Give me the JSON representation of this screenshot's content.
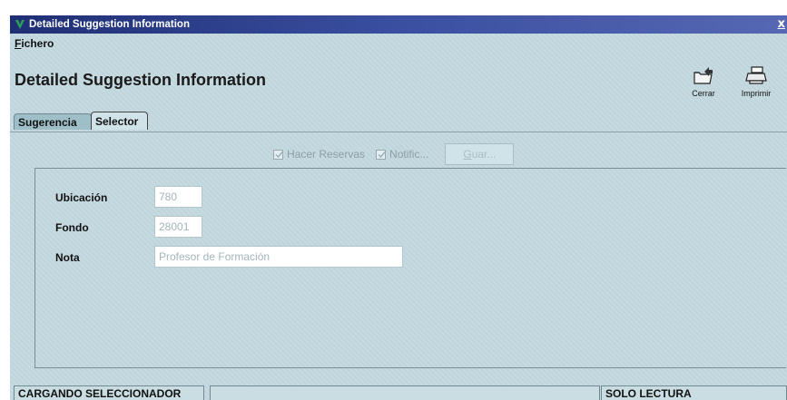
{
  "window": {
    "title": "Detailed Suggestion Information",
    "close_symbol": "x"
  },
  "menu": {
    "file_label_underlined": "F",
    "file_label_rest": "ichero"
  },
  "heading": "Detailed Suggestion Information",
  "toolbar": {
    "close_label": "Cerrar",
    "print_label": "Imprimir",
    "close_icon": "folder-close-icon",
    "print_icon": "printer-icon"
  },
  "tabs": [
    {
      "label": "Sugerencia",
      "active": false
    },
    {
      "label": "Selector",
      "active": true
    }
  ],
  "options": {
    "reserve_label": "Hacer Reservas",
    "reserve_checked": true,
    "notify_label": "Notific...",
    "notify_checked": true,
    "save_label_underlined": "G",
    "save_label_rest": "uar..."
  },
  "fields": {
    "location_label": "Ubicación",
    "location_value": "780",
    "fund_label": "Fondo",
    "fund_value": "28001",
    "note_label": "Nota",
    "note_value": "Profesor de Formación"
  },
  "status": {
    "left": "CARGANDO SELECCIONADOR",
    "middle": "",
    "right": "SOLO LECTURA"
  }
}
